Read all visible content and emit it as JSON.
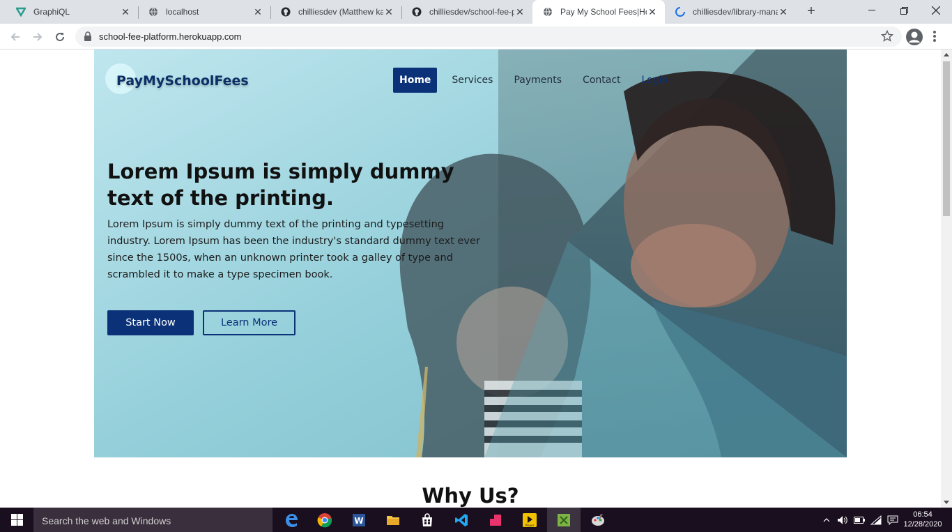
{
  "browser": {
    "tabs": [
      {
        "title": "GraphiQL",
        "icon": "graphiql-icon"
      },
      {
        "title": "localhost",
        "icon": "globe-icon"
      },
      {
        "title": "chilliesdev (Matthew ka",
        "icon": "github-icon"
      },
      {
        "title": "chilliesdev/school-fee-p",
        "icon": "github-icon"
      },
      {
        "title": "Pay My School Fees|Ho",
        "icon": "globe-icon",
        "active": true
      },
      {
        "title": "chilliesdev/library-mana",
        "icon": "loading-icon"
      }
    ],
    "address": "school-fee-platform.herokuapp.com"
  },
  "page": {
    "logo": "PayMySchoolFees",
    "nav": [
      {
        "label": "Home",
        "active": true
      },
      {
        "label": "Services"
      },
      {
        "label": "Payments"
      },
      {
        "label": "Contact"
      },
      {
        "label": "Login"
      }
    ],
    "hero": {
      "title": "Lorem Ipsum is simply dummy text of the printing.",
      "text": "Lorem Ipsum is simply dummy text of the printing and typesetting industry. Lorem Ipsum has been the industry's standard dummy text ever since the 1500s, when an unknown printer took a galley of type and scrambled it to make a type specimen book.",
      "primary_button": "Start Now",
      "secondary_button": "Learn More"
    },
    "section_title": "Why Us?"
  },
  "taskbar": {
    "search_placeholder": "Search the web and Windows",
    "time": "06:54",
    "date": "12/28/2020"
  },
  "colors": {
    "brand": "#0b3278",
    "hero_tint": "#9dd3df"
  }
}
